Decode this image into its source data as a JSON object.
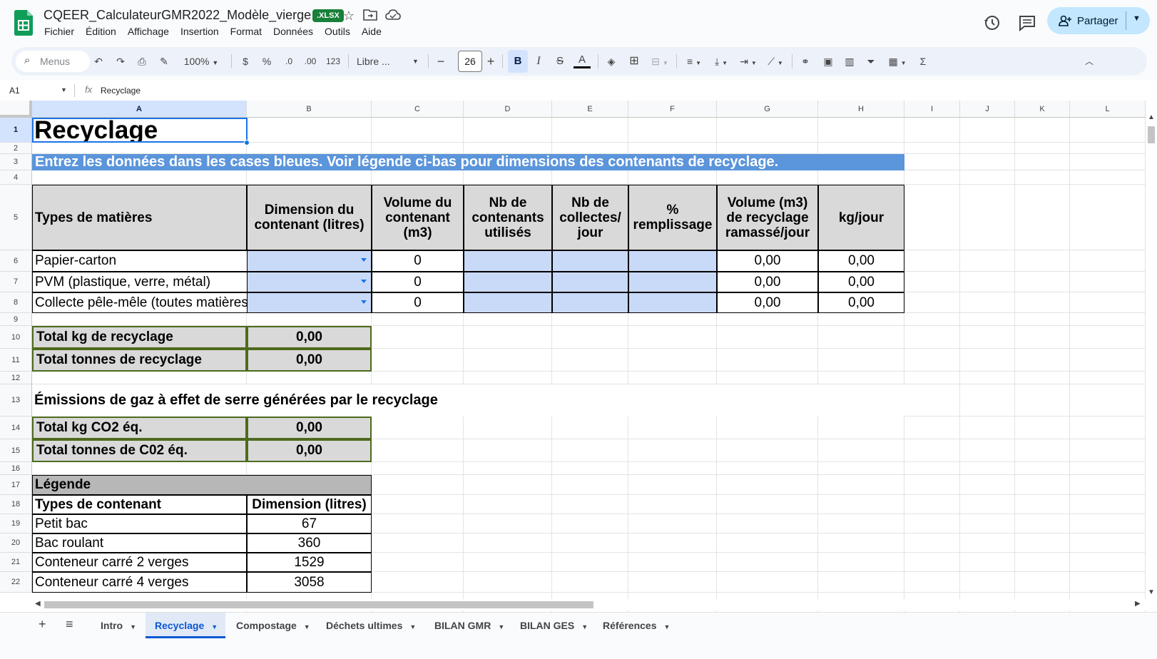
{
  "doc": {
    "title": "CQEER_CalculateurGMR2022_Modèle_vierge",
    "badge": ".XLSX",
    "menus": [
      "Fichier",
      "Édition",
      "Affichage",
      "Insertion",
      "Format",
      "Données",
      "Outils",
      "Aide"
    ],
    "share_label": "Partager"
  },
  "toolbar": {
    "search_placeholder": "Menus",
    "zoom": "100%",
    "currency": "$",
    "percent": "%",
    "dec_dec": ".0",
    "inc_dec": ".00",
    "num_format": "123",
    "font": "Libre ...",
    "font_size": "26",
    "bold": "B",
    "italic": "I",
    "strike": "S",
    "text_color": "A"
  },
  "formula_bar": {
    "cell_ref": "A1",
    "fx": "fx",
    "value": "Recyclage"
  },
  "columns": [
    "A",
    "B",
    "C",
    "D",
    "E",
    "F",
    "G",
    "H",
    "I",
    "J",
    "K",
    "L"
  ],
  "rows": [
    "1",
    "2",
    "3",
    "4",
    "5",
    "6",
    "7",
    "8",
    "9",
    "10",
    "11",
    "12",
    "13",
    "14",
    "15",
    "16",
    "17",
    "18",
    "19",
    "20",
    "21",
    "22"
  ],
  "sheet": {
    "title": "Recyclage",
    "banner": "Entrez les données dans les cases bleues. Voir légende ci-bas pour dimensions des contenants de recyclage.",
    "headers": [
      "Types de matières",
      "Dimension du contenant (litres)",
      "Volume du contenant (m3)",
      "Nb de contenants utilisés",
      "Nb de collectes/ jour",
      "% remplissage",
      "Volume (m3) de recyclage ramassé/jour",
      "kg/jour"
    ],
    "materials": [
      {
        "name": "Papier-carton",
        "volume": "0",
        "vol_day": "0,00",
        "kg_day": "0,00"
      },
      {
        "name": "PVM (plastique, verre, métal)",
        "volume": "0",
        "vol_day": "0,00",
        "kg_day": "0,00"
      },
      {
        "name": "Collecte pêle-mêle (toutes matières)",
        "volume": "0",
        "vol_day": "0,00",
        "kg_day": "0,00"
      }
    ],
    "totals": [
      {
        "label": "Total kg de recyclage",
        "value": "0,00"
      },
      {
        "label": "Total tonnes de recyclage",
        "value": "0,00"
      }
    ],
    "ges_title": "Émissions de gaz à effet de serre générées par le recyclage",
    "ges_totals": [
      {
        "label": "Total kg CO2 éq.",
        "value": "0,00"
      },
      {
        "label": "Total tonnes de C02 éq.",
        "value": "0,00"
      }
    ],
    "legend_title": "Légende",
    "legend_headers": [
      "Types de contenant",
      "Dimension (litres)"
    ],
    "legend_rows": [
      {
        "type": "Petit bac",
        "dim": "67"
      },
      {
        "type": "Bac roulant",
        "dim": "360"
      },
      {
        "type": "Conteneur carré 2 verges",
        "dim": "1529"
      },
      {
        "type": "Conteneur carré 4 verges",
        "dim": "3058"
      }
    ]
  },
  "tabs": [
    {
      "label": "Intro",
      "active": false
    },
    {
      "label": "Recyclage",
      "active": true
    },
    {
      "label": "Compostage",
      "active": false
    },
    {
      "label": "Déchets ultimes",
      "active": false
    },
    {
      "label": "BILAN GMR",
      "active": false
    },
    {
      "label": "BILAN GES",
      "active": false
    },
    {
      "label": "Références",
      "active": false
    }
  ],
  "colors": {
    "accent": "#1a73e8",
    "banner": "#5b95db",
    "input_cell": "#c9daf8",
    "header_cell": "#d9d9d9",
    "total_border": "#4e6a1d"
  }
}
